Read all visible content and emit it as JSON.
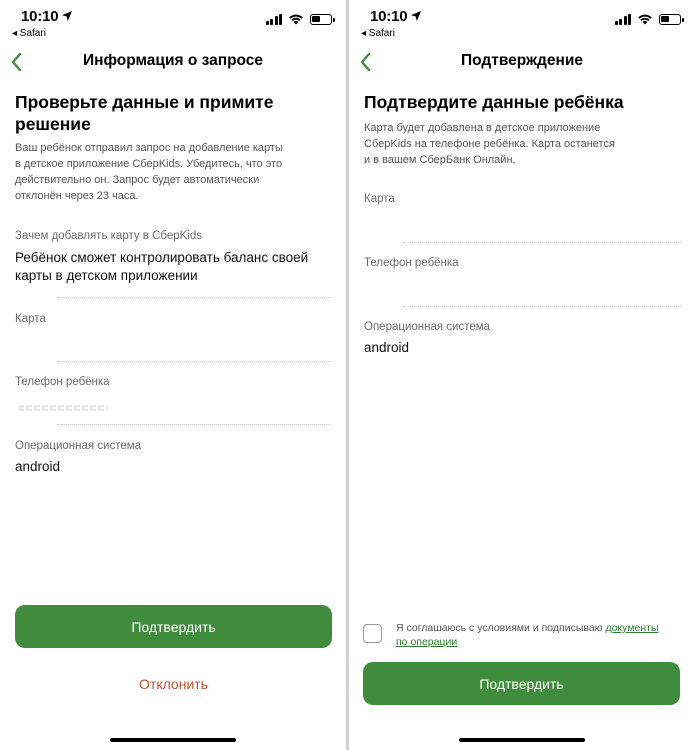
{
  "status_bar": {
    "time": "10:10",
    "back_app": "◂ Safari"
  },
  "left": {
    "nav_title": "Информация о запросе",
    "heading_line1": "Проверьте данные и примите",
    "heading_line2": "решение",
    "desc_lines": [
      "Ваш ребёнок отправил запрос на добавление карты",
      "в детское приложение СберKids. Убедитесь, что это",
      "действительно он. Запрос будет автоматически",
      "отклонён через 23 часа."
    ],
    "fields": {
      "reason_label": "Зачем добавлять карту в СберKids",
      "reason_line1": "Ребёнок сможет контролировать баланс своей",
      "reason_line2": "карты в детском приложении",
      "card_label": "Карта",
      "phone_label": "Телефон ребёнка",
      "os_label": "Операционная система",
      "os_value": "android"
    },
    "confirm_button": "Подтвердить",
    "decline_button": "Отклонить"
  },
  "right": {
    "nav_title": "Подтверждение",
    "heading": "Подтвердите данные ребёнка",
    "desc_lines": [
      "Карта будет добавлена в детское приложение",
      "СберKids на телефоне ребёнка. Карта останется",
      "и в вашем СберБанк Онлайн."
    ],
    "fields": {
      "card_label": "Карта",
      "phone_label": "Телефон ребёнка",
      "os_label": "Операционная система",
      "os_value": "android"
    },
    "consent_text": "Я соглашаюсь с условиями и подписываю ",
    "consent_link_part1": "документы",
    "consent_link_part2": "по операции",
    "confirm_button": "Подтвердить"
  },
  "colors": {
    "accent_green": "#3f8c3c",
    "decline_red": "#c4512b",
    "link_green": "#2f7d32"
  },
  "icons": [
    "location-arrow-icon",
    "cellular-signal-icon",
    "wifi-icon",
    "battery-icon",
    "back-chevron-icon"
  ]
}
